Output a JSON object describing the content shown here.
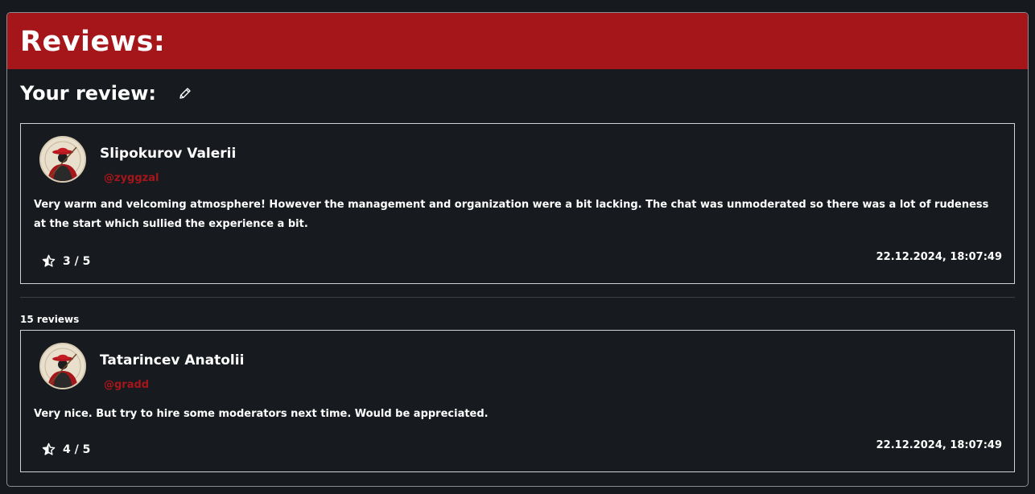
{
  "header": {
    "title": "Reviews:"
  },
  "your_review": {
    "title": "Your review:"
  },
  "my_review": {
    "author_name": "Slipokurov Valerii",
    "author_handle": "@zyggzal",
    "text": "Very warm and velcoming atmosphere! However the management and organization were a bit lacking. The chat was unmoderated so there was a lot of rudeness at the start which sullied the experience a bit.",
    "rating": "3 / 5",
    "date": "22.12.2024, 18:07:49"
  },
  "reviews_count": "15 reviews",
  "reviews": [
    {
      "author_name": "Tatarincev Anatolii",
      "author_handle": "@gradd",
      "text": "Very nice. But try to hire some moderators next time. Would be appreciated.",
      "rating": "4 / 5",
      "date": "22.12.2024, 18:07:49"
    }
  ],
  "colors": {
    "accent": "#a5161b",
    "background": "#171a1e",
    "text": "#ffffff",
    "card_border": "#cfd2d6"
  },
  "icons": [
    "pencil-icon",
    "half-star-icon",
    "avatar-image"
  ]
}
